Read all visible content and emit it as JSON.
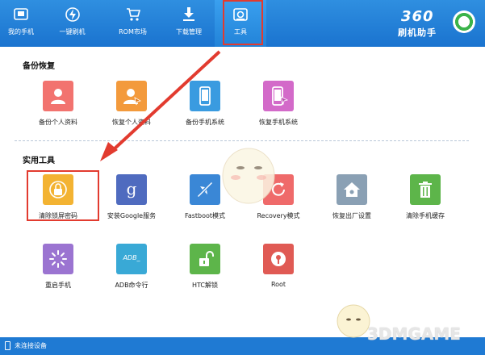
{
  "nav": {
    "items": [
      {
        "label": "我的手机",
        "icon": "phone-icon"
      },
      {
        "label": "一键刷机",
        "icon": "flash-icon"
      },
      {
        "label": "ROM市场",
        "icon": "cart-icon"
      },
      {
        "label": "下载管理",
        "icon": "download-icon"
      },
      {
        "label": "工具",
        "icon": "toolbox-icon",
        "active": true
      }
    ]
  },
  "brand": {
    "line1": "360",
    "line2": "刷机助手"
  },
  "sections": {
    "backup": {
      "title": "备份恢复",
      "items": [
        {
          "label": "备份个人资料",
          "icon": "user-backup-icon",
          "color": "#f2736f"
        },
        {
          "label": "恢复个人资料",
          "icon": "user-restore-icon",
          "color": "#f39a3c"
        },
        {
          "label": "备份手机系统",
          "icon": "phone-backup-icon",
          "color": "#3a9be0"
        },
        {
          "label": "恢复手机系统",
          "icon": "phone-restore-icon",
          "color": "#d36ac9"
        }
      ]
    },
    "tools": {
      "title": "实用工具",
      "items": [
        {
          "label": "清除锁屏密码",
          "icon": "lock-icon",
          "color": "#f3b332"
        },
        {
          "label": "安装Google服务",
          "icon": "google-icon",
          "color": "#4f6bbf"
        },
        {
          "label": "Fastboot模式",
          "icon": "fastboot-icon",
          "color": "#3a87d6"
        },
        {
          "label": "Recovery模式",
          "icon": "recovery-icon",
          "color": "#ef6a6a"
        },
        {
          "label": "恢复出厂设置",
          "icon": "factory-reset-icon",
          "color": "#8aa0b4"
        },
        {
          "label": "清除手机缓存",
          "icon": "trash-icon",
          "color": "#5db54a"
        },
        {
          "label": "重启手机",
          "icon": "reboot-icon",
          "color": "#9b74d1"
        },
        {
          "label": "ADB命令行",
          "icon": "adb-icon",
          "color": "#39a9d6"
        },
        {
          "label": "HTC解锁",
          "icon": "unlock-icon",
          "color": "#5db54a"
        },
        {
          "label": "Root",
          "icon": "root-icon",
          "color": "#e05a54"
        }
      ]
    }
  },
  "statusbar": {
    "text": "未连接设备"
  },
  "adb_tile_text": "ADB_",
  "google_tile_text": "g",
  "watermark": {
    "text": "3DMGAME"
  },
  "colors": {
    "accent": "#1f7ad3",
    "highlight": "#e23b2f"
  }
}
